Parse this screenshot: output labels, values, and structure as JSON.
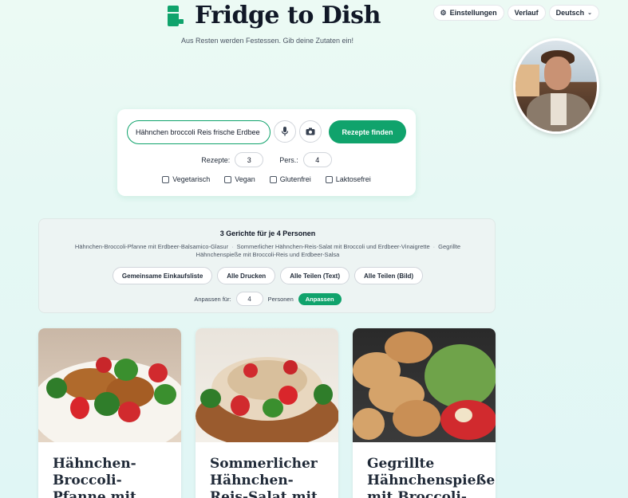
{
  "header": {
    "title": "Fridge to Dish",
    "subtitle": "Aus Resten werden Festessen. Gib deine Zutaten ein!",
    "logo_icon": "fridge-icon"
  },
  "nav": {
    "settings_label": "Einstellungen",
    "settings_icon": "gear-icon",
    "history_label": "Verlauf",
    "language_label": "Deutsch",
    "language_icon": "chevron-down-icon"
  },
  "search": {
    "value": "Hähnchen broccoli Reis frische Erdbee",
    "mic_icon": "microphone-icon",
    "camera_icon": "camera-icon",
    "find_label": "Rezepte finden",
    "recipes_label": "Rezepte:",
    "recipes_value": "3",
    "persons_label": "Pers.:",
    "persons_value": "4"
  },
  "diets": [
    {
      "label": "Vegetarisch",
      "checked": false
    },
    {
      "label": "Vegan",
      "checked": false
    },
    {
      "label": "Glutenfrei",
      "checked": false
    },
    {
      "label": "Laktosefrei",
      "checked": false
    }
  ],
  "summary": {
    "title": "3 Gerichte für je 4 Personen",
    "dishes": [
      "Hähnchen-Broccoli-Pfanne mit Erdbeer-Balsamico-Glasur",
      "Sommerlicher Hähnchen-Reis-Salat mit Broccoli und Erdbeer-Vinaigrette",
      "Gegrillte Hähnchenspieße mit Broccoli-Reis und Erdbeer-Salsa"
    ],
    "separator": "·",
    "actions": [
      "Gemeinsame Einkaufsliste",
      "Alle Drucken",
      "Alle Teilen (Text)",
      "Alle Teilen (Bild)"
    ],
    "adjust_label": "Anpassen für:",
    "adjust_value": "4",
    "adjust_unit": "Personen",
    "adjust_button": "Anpassen"
  },
  "cards": [
    {
      "title": "Hähnchen-Broccoli-Pfanne mit Erdbeer"
    },
    {
      "title": "Sommerlicher Hähnchen-Reis-Salat mit Broccoli"
    },
    {
      "title": "Gegrillte Hähnchenspieße mit Broccoli-Reis"
    }
  ],
  "colors": {
    "accent": "#10a36c",
    "background": "#e6f8f4",
    "text": "#111827"
  }
}
